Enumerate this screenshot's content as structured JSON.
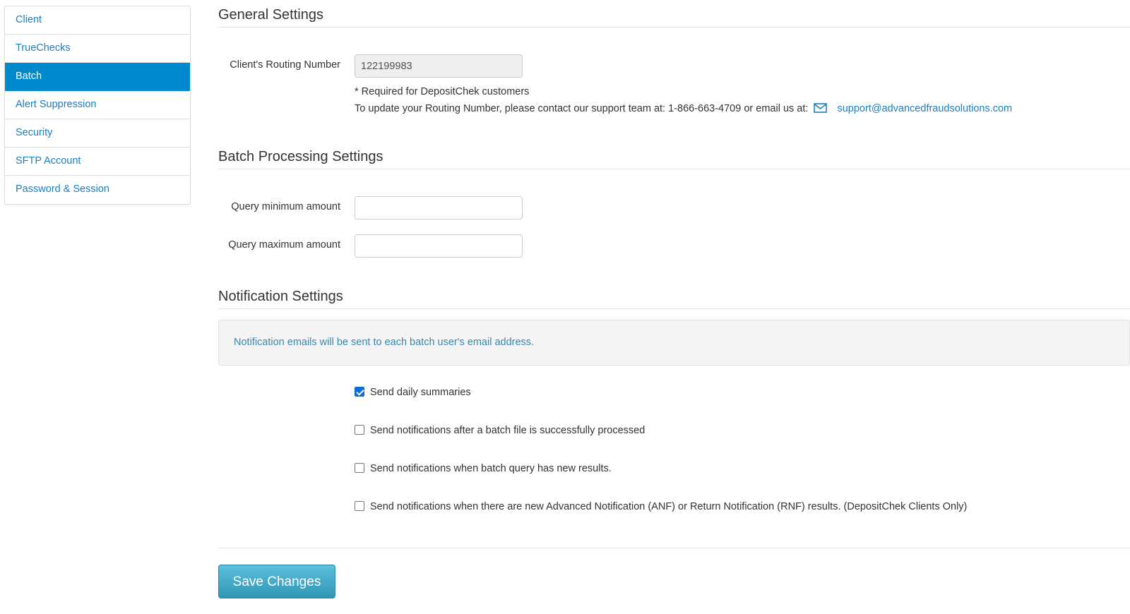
{
  "sidebar": {
    "items": [
      {
        "label": "Client"
      },
      {
        "label": "TrueChecks"
      },
      {
        "label": "Batch",
        "active": true
      },
      {
        "label": "Alert Suppression"
      },
      {
        "label": "Security"
      },
      {
        "label": "SFTP Account"
      },
      {
        "label": "Password & Session"
      }
    ]
  },
  "general": {
    "title": "General Settings",
    "routing_label": "Client's Routing Number",
    "routing_value": "122199983",
    "required_note": "* Required for DepositChek customers",
    "update_note": "To update your Routing Number, please contact our support team at: 1-866-663-4709 or email us at:",
    "support_email": "support@advancedfraudsolutions.com",
    "email_icon": "envelope-icon"
  },
  "batch": {
    "title": "Batch Processing Settings",
    "min_label": "Query minimum amount",
    "min_value": "",
    "max_label": "Query maximum amount",
    "max_value": ""
  },
  "notifications": {
    "title": "Notification Settings",
    "info": "Notification emails will be sent to each batch user's email address.",
    "options": [
      {
        "label": "Send daily summaries",
        "checked": true
      },
      {
        "label": "Send notifications after a batch file is successfully processed",
        "checked": false
      },
      {
        "label": "Send notifications when batch query has new results.",
        "checked": false
      },
      {
        "label": "Send notifications when there are new Advanced Notification (ANF) or Return Notification (RNF) results. (DepositChek Clients Only)",
        "checked": false
      }
    ]
  },
  "actions": {
    "save_label": "Save Changes"
  },
  "colors": {
    "accent": "#0088cc",
    "link": "#1a7fc1",
    "button": "#49afcd",
    "info_text": "#3a87ad"
  }
}
